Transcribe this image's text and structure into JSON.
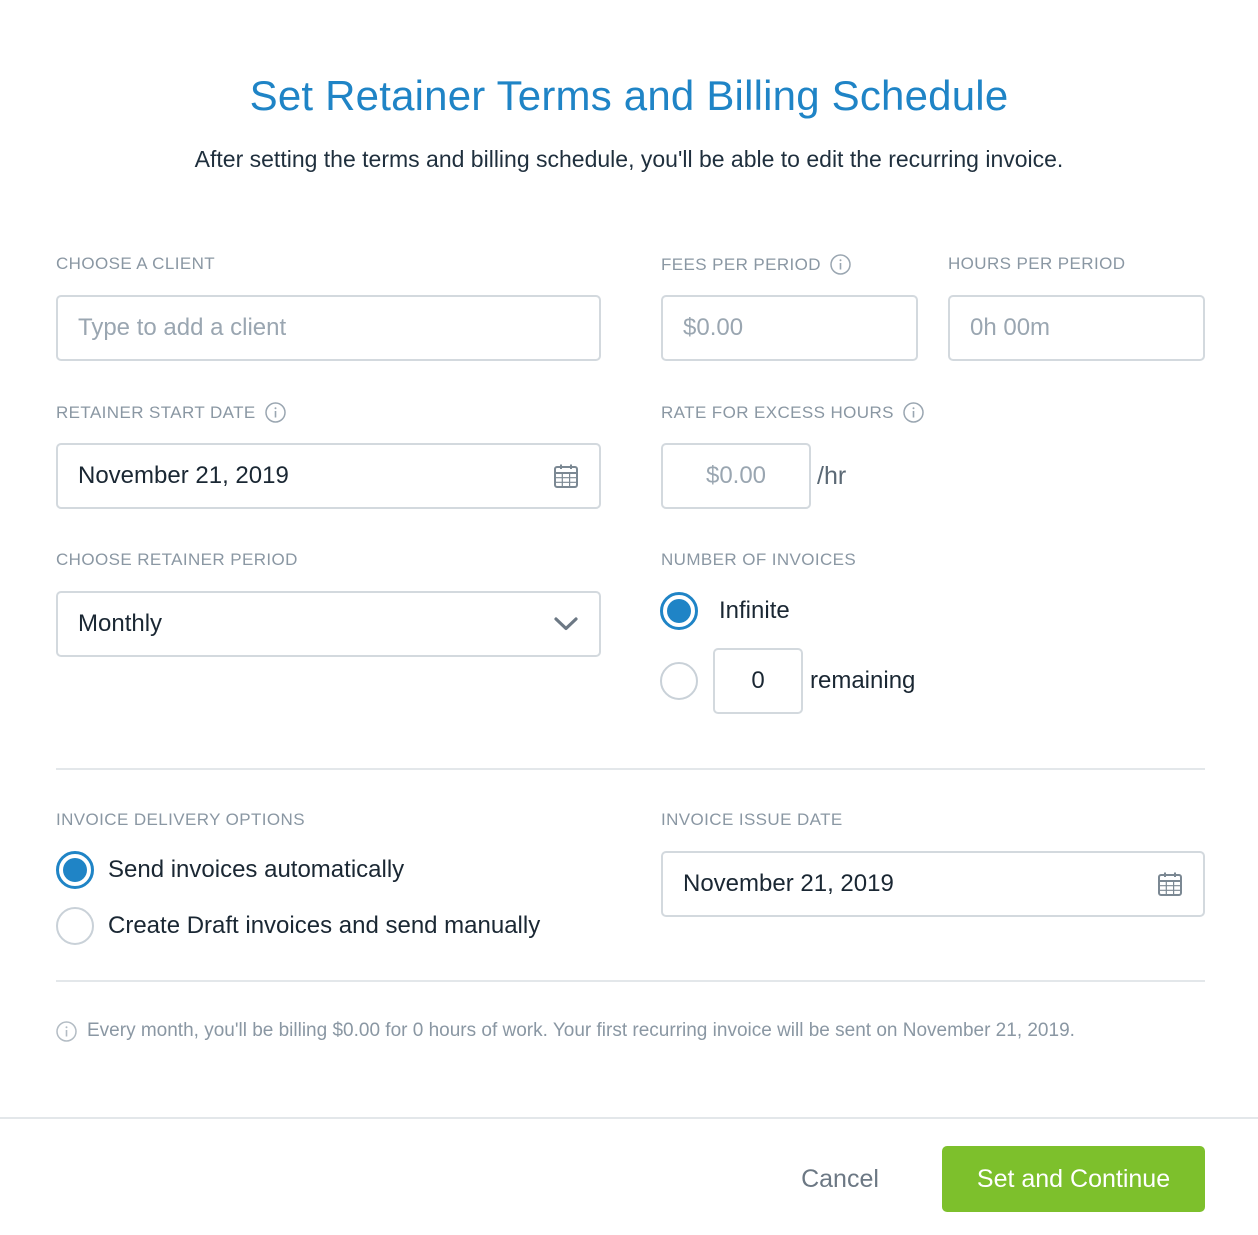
{
  "header": {
    "title": "Set Retainer Terms and Billing Schedule",
    "subtitle": "After setting the terms and billing schedule, you'll be able to edit the recurring invoice."
  },
  "client": {
    "label": "CHOOSE A CLIENT",
    "placeholder": "Type to add a client"
  },
  "fees": {
    "label": "FEES PER PERIOD",
    "placeholder": "$0.00"
  },
  "hours": {
    "label": "HOURS PER PERIOD",
    "placeholder": "0h 00m"
  },
  "start_date": {
    "label": "RETAINER START DATE",
    "value": "November 21, 2019"
  },
  "excess_rate": {
    "label": "RATE FOR EXCESS HOURS",
    "placeholder": "$0.00",
    "unit": "/hr"
  },
  "period": {
    "label": "CHOOSE RETAINER PERIOD",
    "value": "Monthly"
  },
  "invoices": {
    "label": "NUMBER OF INVOICES",
    "infinite_label": "Infinite",
    "infinite_selected": true,
    "remaining_value": "0",
    "remaining_label": "remaining"
  },
  "delivery": {
    "label": "INVOICE DELIVERY OPTIONS",
    "auto_label": "Send invoices automatically",
    "auto_selected": true,
    "draft_label": "Create Draft invoices and send manually"
  },
  "issue_date": {
    "label": "INVOICE ISSUE DATE",
    "value": "November 21, 2019"
  },
  "summary": "Every month, you'll be billing $0.00 for 0 hours of work. Your first recurring invoice will be sent on November 21, 2019.",
  "footer": {
    "cancel_label": "Cancel",
    "submit_label": "Set and Continue"
  },
  "colors": {
    "accent": "#1f84c6",
    "primary_button": "#7dc02c",
    "label_gray": "#8a97a3"
  },
  "icons": [
    "info-icon",
    "calendar-icon",
    "chevron-down-icon"
  ]
}
